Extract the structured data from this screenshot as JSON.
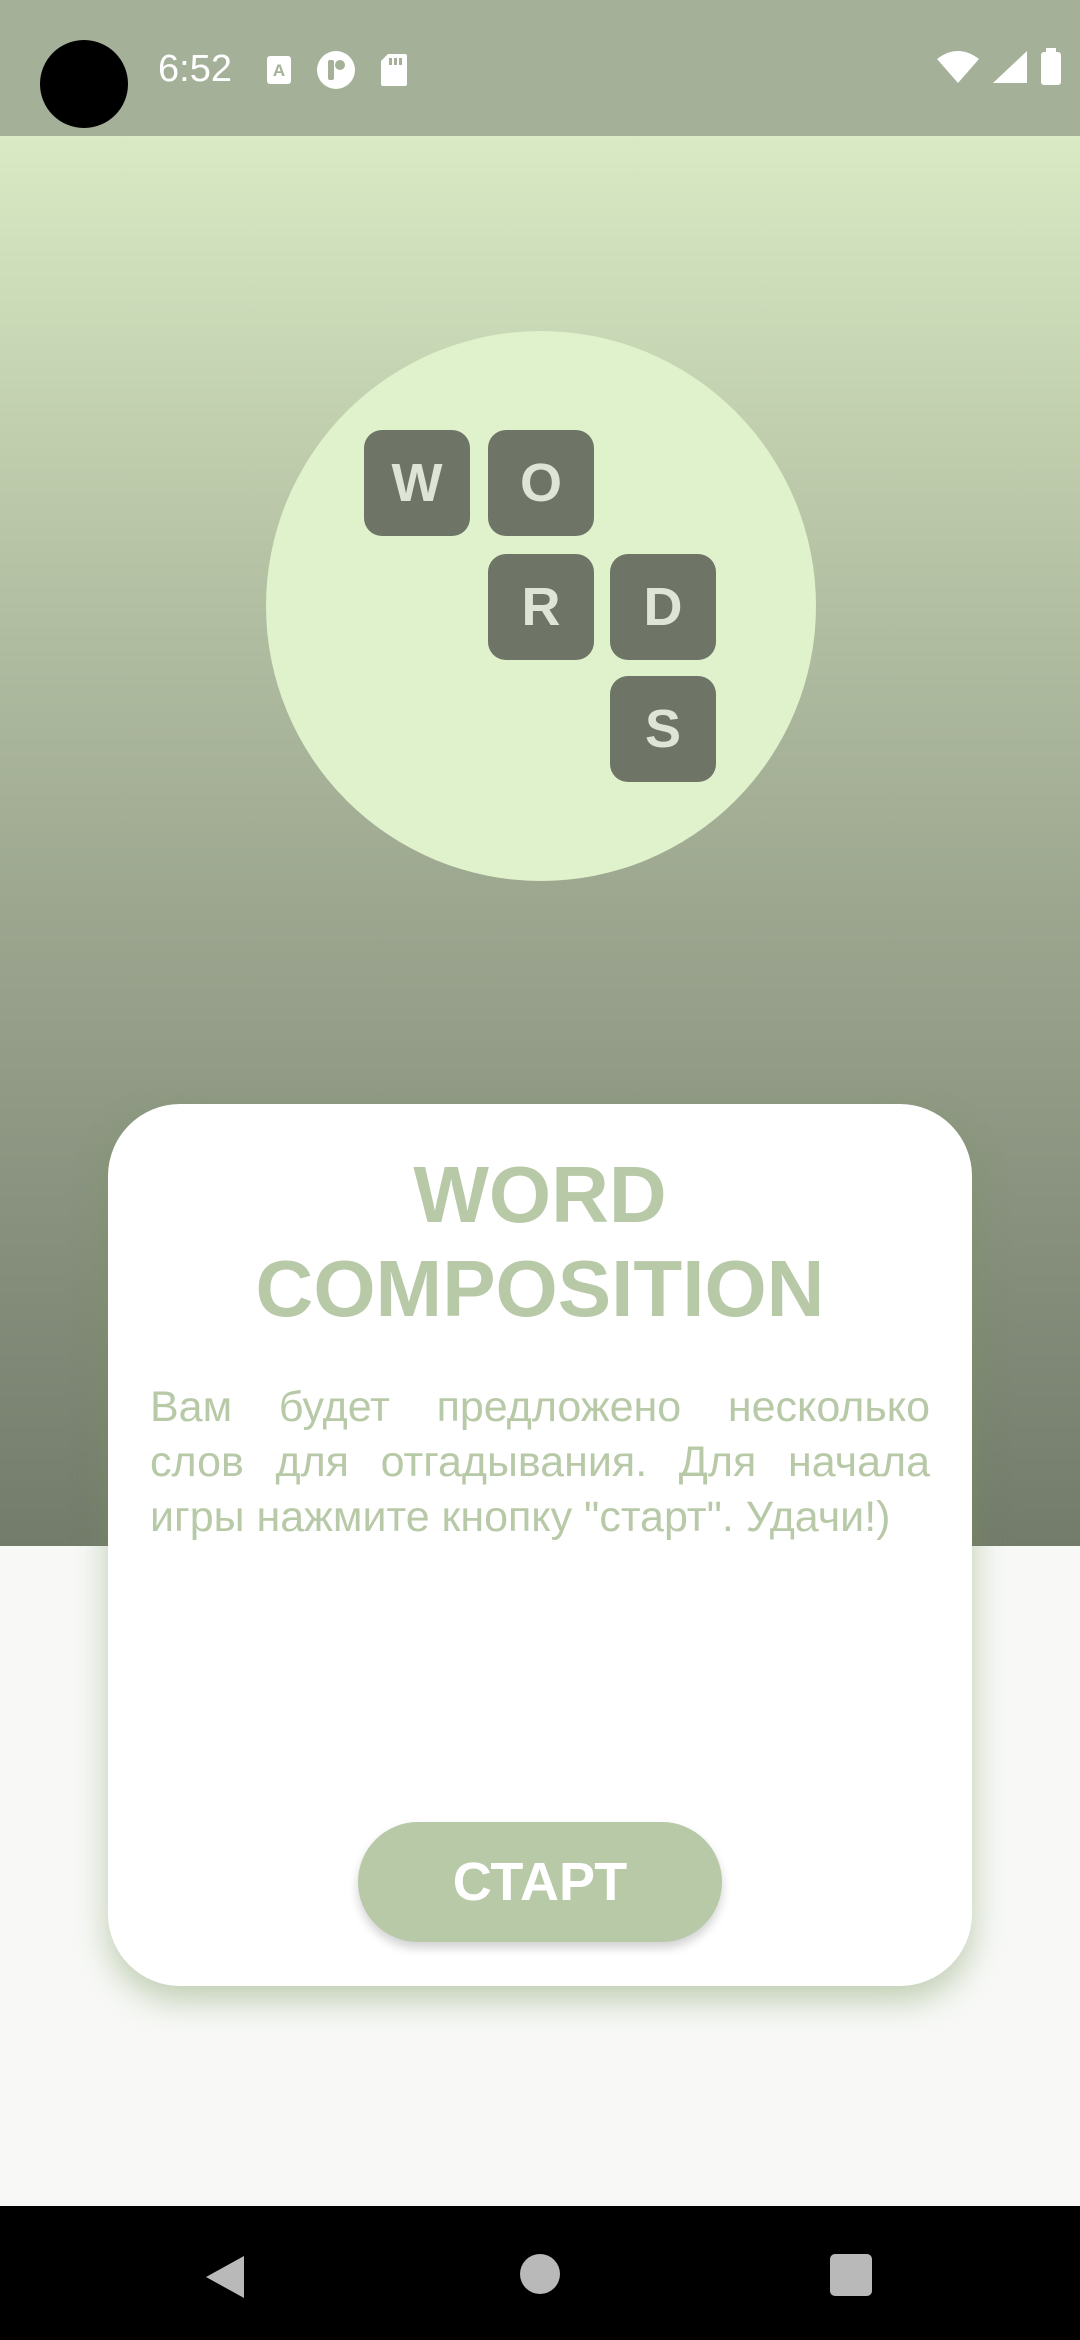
{
  "status_bar": {
    "time": "6:52",
    "icons_left": [
      "font-download-icon",
      "app-notification-icon",
      "sd-card-icon"
    ],
    "icons_right": [
      "wifi-icon",
      "signal-icon",
      "battery-icon"
    ]
  },
  "logo": {
    "tiles": [
      "W",
      "O",
      "R",
      "D",
      "S"
    ]
  },
  "card": {
    "title_line1": "WORD",
    "title_line2": "COMPOSITION",
    "description": "Вам будет предложено несколько слов для отгадывания. Для начала игры нажмите кнопку \"старт\". Удачи!)",
    "start_label": "СТАРТ"
  },
  "nav_bar": {
    "icons": [
      "back-icon",
      "home-icon",
      "recents-icon"
    ]
  },
  "colors": {
    "accent": "#b8c9a8",
    "tile": "#6e7466",
    "circle": "#dff2cc"
  }
}
